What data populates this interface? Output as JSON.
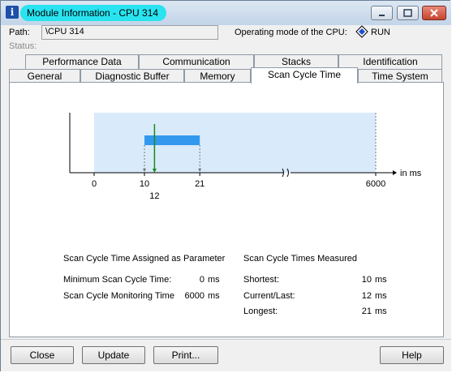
{
  "window": {
    "title": "Module Information - CPU 314",
    "path_label": "Path:",
    "path_value": "\\CPU 314",
    "status_label": "Status:",
    "operating_mode_label": "Operating mode of the  CPU:",
    "operating_mode_value": "RUN"
  },
  "tabs": {
    "row_top": [
      "Performance Data",
      "Communication",
      "Stacks",
      "Identification"
    ],
    "row_bottom": [
      "General",
      "Diagnostic Buffer",
      "Memory",
      "Scan Cycle Time",
      "Time System"
    ],
    "active": "Scan Cycle Time"
  },
  "chart": {
    "axis_unit_label": "in ms",
    "tick_labels": [
      "0",
      "10",
      "21",
      "6000"
    ],
    "current_label": "12",
    "colors": {
      "range_fill": "#d9eafb",
      "bar_fill": "#3399ee",
      "current_line": "#1a8a1a"
    }
  },
  "chart_data": {
    "type": "bar",
    "shortest_ms": 10,
    "current_ms": 12,
    "longest_ms": 21,
    "monitoring_ms": 6000,
    "axis_min_ms": 0,
    "axis_max_ms": 6000,
    "axis_break": true
  },
  "assigned": {
    "heading": "Scan Cycle Time Assigned as Parameter",
    "min_label": "Minimum Scan Cycle Time:",
    "min_value": "0",
    "min_unit": "ms",
    "monitor_label": "Scan Cycle Monitoring Time",
    "monitor_value": "6000",
    "monitor_unit": "ms"
  },
  "measured": {
    "heading": "Scan Cycle Times Measured",
    "shortest_label": "Shortest:",
    "shortest_value": "10",
    "shortest_unit": "ms",
    "current_label": "Current/Last:",
    "current_value": "12",
    "current_unit": "ms",
    "longest_label": "Longest:",
    "longest_value": "21",
    "longest_unit": "ms"
  },
  "buttons": {
    "close": "Close",
    "update": "Update",
    "print": "Print...",
    "help": "Help"
  }
}
